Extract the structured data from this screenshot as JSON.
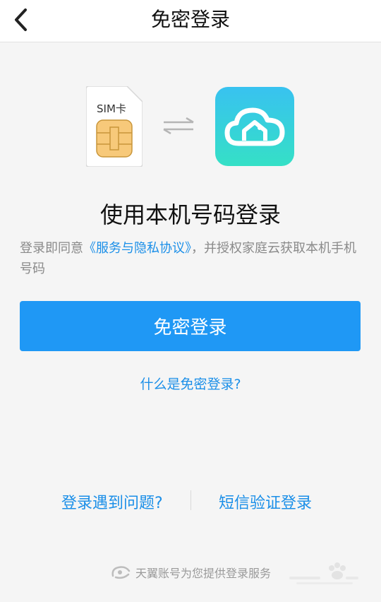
{
  "header": {
    "title": "免密登录",
    "back_icon": "chevron-left-icon"
  },
  "illustration": {
    "sim_label": "SIM卡",
    "swap_icon": "swap-arrows-icon",
    "app_logo_icon": "cloud-home-icon",
    "logo_gradient": [
      "#38c2f0",
      "#35e0c6"
    ]
  },
  "main": {
    "title": "使用本机号码登录",
    "agreement_prefix": "登录即同意",
    "agreement_link": "《服务与隐私协议》",
    "agreement_suffix": "，并授权家庭云获取本机手机号码",
    "login_button": "免密登录",
    "what_link": "什么是免密登录?"
  },
  "bottom": {
    "problem_link": "登录遇到问题?",
    "sms_login_link": "短信验证登录"
  },
  "footer": {
    "provider_icon": "tianyi-logo-icon",
    "text": "天翼账号为您提供登录服务"
  },
  "colors": {
    "accent": "#1f98f5",
    "link": "#1b8fe8",
    "background": "#f5f5f5"
  }
}
